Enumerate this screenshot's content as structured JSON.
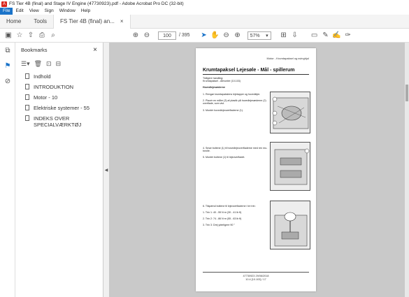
{
  "window": {
    "title": "FS Tier 4B (final) and Stage IV Engine (47730923).pdf - Adobe Acrobat Pro DC (32-bit)"
  },
  "menu": [
    "File",
    "Edit",
    "View",
    "Sign",
    "Window",
    "Help"
  ],
  "tabs": {
    "home": "Home",
    "tools": "Tools",
    "document": "FS Tier 4B (final) an...",
    "close": "×"
  },
  "toolbar": {
    "page_current": "100",
    "page_total": "/ 395",
    "zoom": "57%"
  },
  "bookmarks": {
    "title": "Bookmarks",
    "close": "×",
    "items": [
      "Indhold",
      "INTRODUKTION",
      "Motor - 10",
      "Elektriske systemer - 55",
      "INDEKS OVER SPECIALVÆRKTØJ"
    ]
  },
  "page": {
    "header": "Motor - Krumtapaksel og svinghjul",
    "title": "Krumtapaksel Lejesøle - Mål - spillerum",
    "prev_op_label": "Tidligere handling:",
    "prev_op": "Krumtapaksel - Afmontér (10.103)",
    "section": "Hovedlejesæderne",
    "steps1": [
      "1.  Rengør krumtapakslens lejetapper og hovedlejer.",
      "2.  Placér en måler (3) af plastik på hovedlejesæderne (2)\n     overflade, som vist.",
      "3.  Montér hovedlejeoverfladerne (1)."
    ],
    "steps2": [
      "4.  Smør boltene (1) til hovedlejeoverfladerne med ren mo-\n     torolie.",
      "5.  Montér boltene (1) til lejeoverfladet."
    ],
    "steps3": [
      "6.  Tilspænd boltene til lejeoverfladerne i tre trin:",
      "     1.  Trin 1:  40 - 55 N·m (30 - 41 lb ft)",
      "     2.  Trin 2:  74 - 86 N·m (55 - 63 lb ft)",
      "     3.  Trin 3:  Drej yderligere 90 °"
    ],
    "footer1": "47730923 29/06/2018",
    "footer2": "10.4 [10.103] / 17"
  }
}
